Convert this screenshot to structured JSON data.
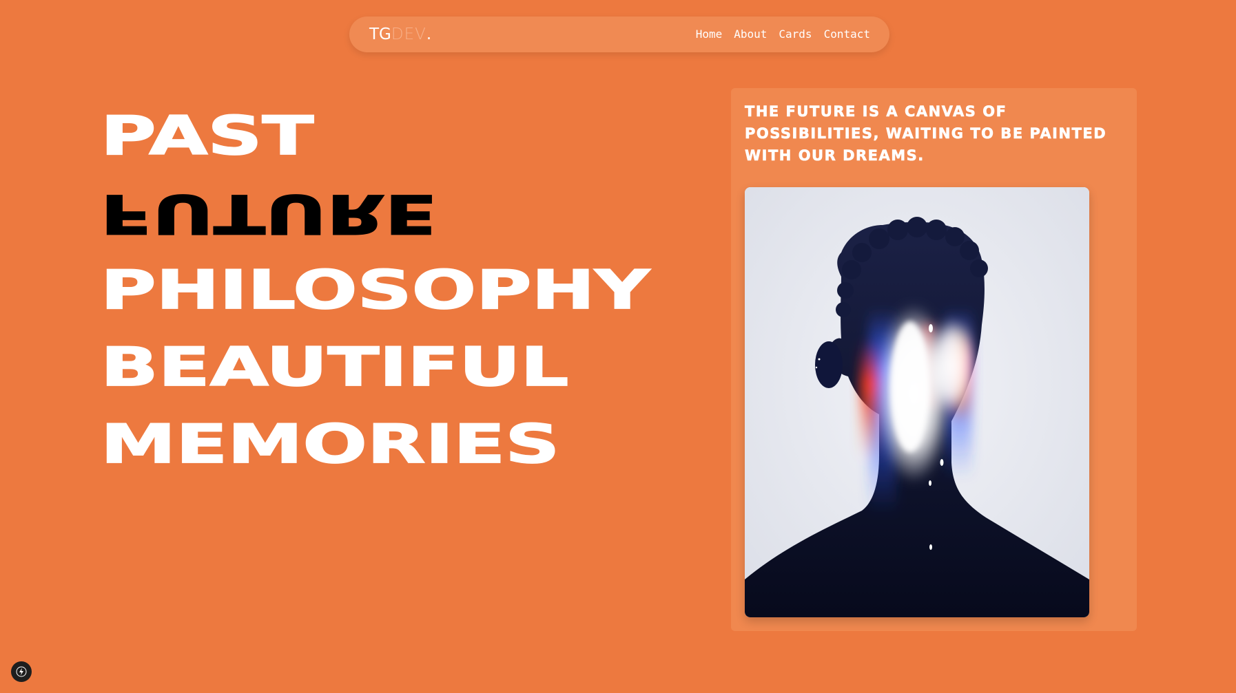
{
  "logo": {
    "part1": "TG",
    "part2": "DEV",
    "part3": "."
  },
  "nav": {
    "items": [
      {
        "label": "Home"
      },
      {
        "label": "About"
      },
      {
        "label": "Cards"
      },
      {
        "label": "Contact"
      }
    ]
  },
  "hero": {
    "words": [
      "PAST",
      "FUTURE",
      "PHILOSOPHY",
      "BEAUTIFUL",
      "MEMORIES"
    ]
  },
  "card": {
    "quote": "THE FUTURE IS A CANVAS OF POSSIBILITIES, WAITING TO BE PAINTED WITH OUR DREAMS."
  },
  "colors": {
    "background": "#ED793F",
    "navbar": "#F08A53",
    "card": "#F0884F",
    "text": "#FFFFFF",
    "accent_dark": "#000000"
  },
  "icons": {
    "badge": "lightning-bolt-icon"
  }
}
